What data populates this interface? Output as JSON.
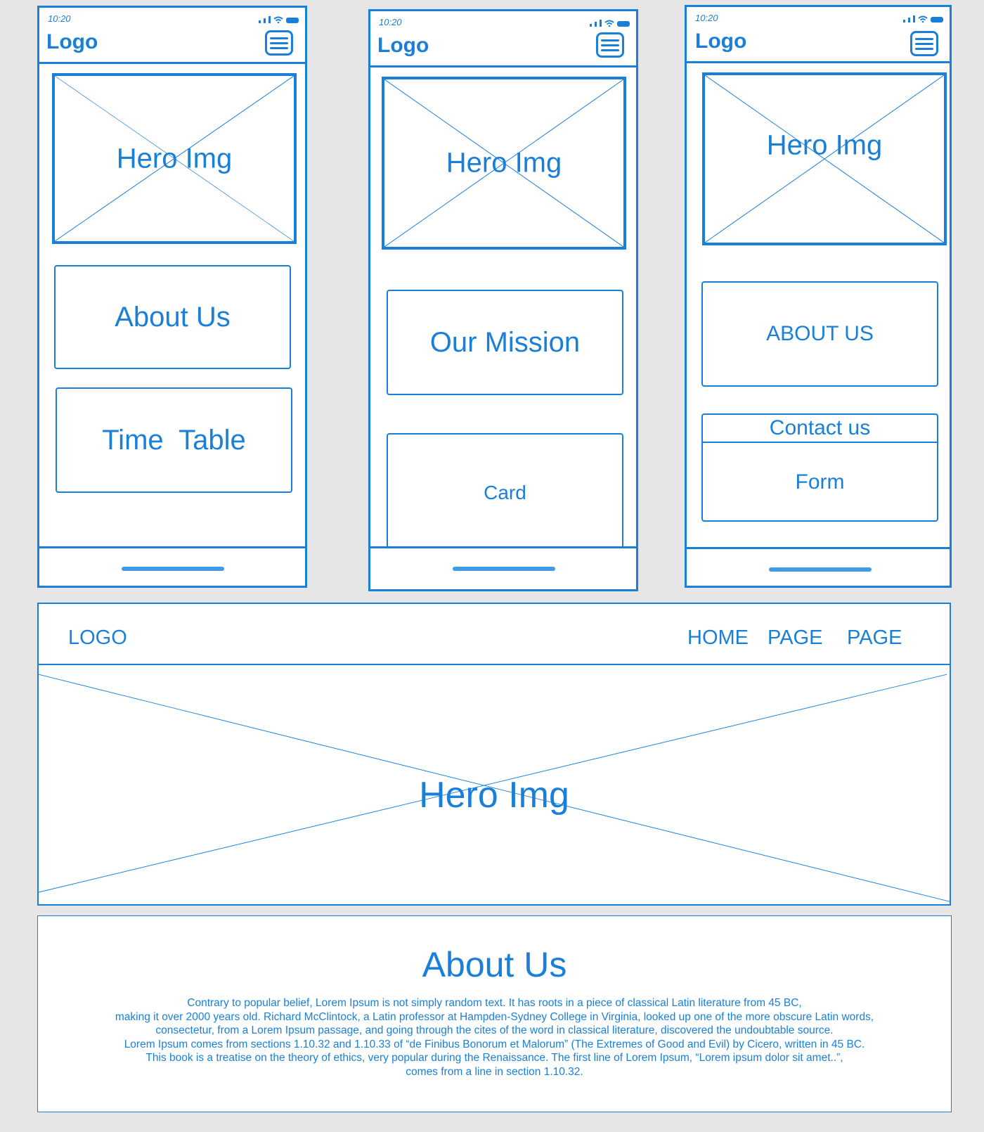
{
  "mobile": {
    "status_time": "10:20",
    "logo": "Logo",
    "screens": [
      {
        "hero_label": "Hero Img",
        "card1": "About Us",
        "card2": "Time  Table"
      },
      {
        "hero_label": "Hero Img",
        "card1": "Our Mission",
        "card2": "Card"
      },
      {
        "hero_label": "Hero Img",
        "card1": "ABOUT US",
        "card2_header": "Contact us",
        "card2_body": "Form"
      }
    ]
  },
  "desktop": {
    "logo": "LOGO",
    "nav": [
      "HOME",
      "PAGE",
      "PAGE"
    ],
    "hero_label": "Hero Img",
    "about_title": "About Us",
    "about_text": "Contrary to popular belief, Lorem Ipsum is not simply random text. It has roots in a piece of classical Latin literature from 45 BC,\nmaking it over 2000 years old. Richard McClintock, a Latin professor at Hampden-Sydney College in Virginia, looked up one of the more obscure Latin words,\nconsectetur, from a Lorem Ipsum passage, and going through the cites of the word in classical literature, discovered the undoubtable source.\nLorem Ipsum comes from sections 1.10.32 and 1.10.33 of “de Finibus Bonorum et Malorum” (The Extremes of Good and Evil) by Cicero, written in 45 BC.\nThis book is a treatise on the theory of ethics, very popular during the Renaissance. The first line of Lorem Ipsum, “Lorem ipsum dolor sit amet..”,\ncomes from a line in section 1.10.32."
  },
  "colors": {
    "accent": "#1a7fd9",
    "background": "#e6e6e6"
  }
}
